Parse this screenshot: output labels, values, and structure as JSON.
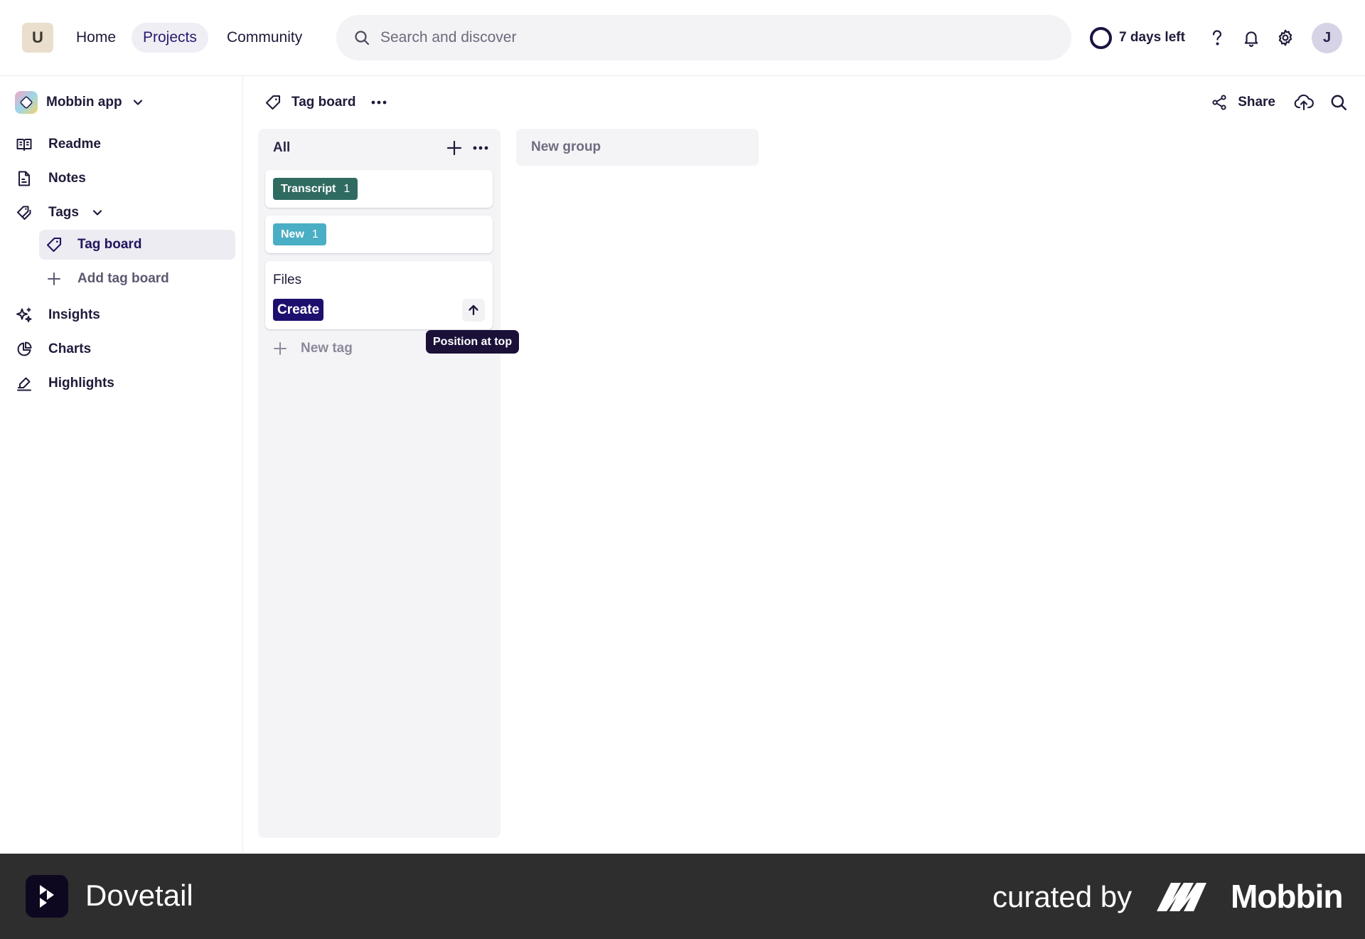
{
  "topnav": {
    "org_initial": "U",
    "links": [
      {
        "label": "Home"
      },
      {
        "label": "Projects"
      },
      {
        "label": "Community"
      }
    ],
    "search_placeholder": "Search and discover",
    "trial_text": "7 days left",
    "user_initial": "J"
  },
  "sidebar": {
    "project_name": "Mobbin app",
    "items": [
      {
        "label": "Readme",
        "icon": "book-icon"
      },
      {
        "label": "Notes",
        "icon": "document-icon"
      },
      {
        "label": "Tags",
        "icon": "tags-icon"
      },
      {
        "label": "Tag board",
        "icon": "tag-icon"
      },
      {
        "label": "Add tag board",
        "icon": "plus-icon"
      },
      {
        "label": "Insights",
        "icon": "sparkle-icon"
      },
      {
        "label": "Charts",
        "icon": "pie-chart-icon"
      },
      {
        "label": "Highlights",
        "icon": "highlighter-icon"
      }
    ]
  },
  "header": {
    "title": "Tag board",
    "share_label": "Share"
  },
  "board": {
    "column": {
      "title": "All",
      "tags": [
        {
          "label": "Transcript",
          "count": "1",
          "color": "#2f6b61"
        },
        {
          "label": "New",
          "count": "1",
          "color": "#4aaec4"
        }
      ],
      "editor": {
        "value": "Files",
        "create_label": "Create",
        "tooltip": "Position at top"
      },
      "new_tag_label": "New tag"
    },
    "new_group_label": "New group"
  },
  "footer": {
    "brand": "Dovetail",
    "curated_by": "curated by",
    "curator": "Mobbin"
  },
  "colors": {
    "accent": "#1d0f6e",
    "footer_bg": "#2e2e2e"
  }
}
